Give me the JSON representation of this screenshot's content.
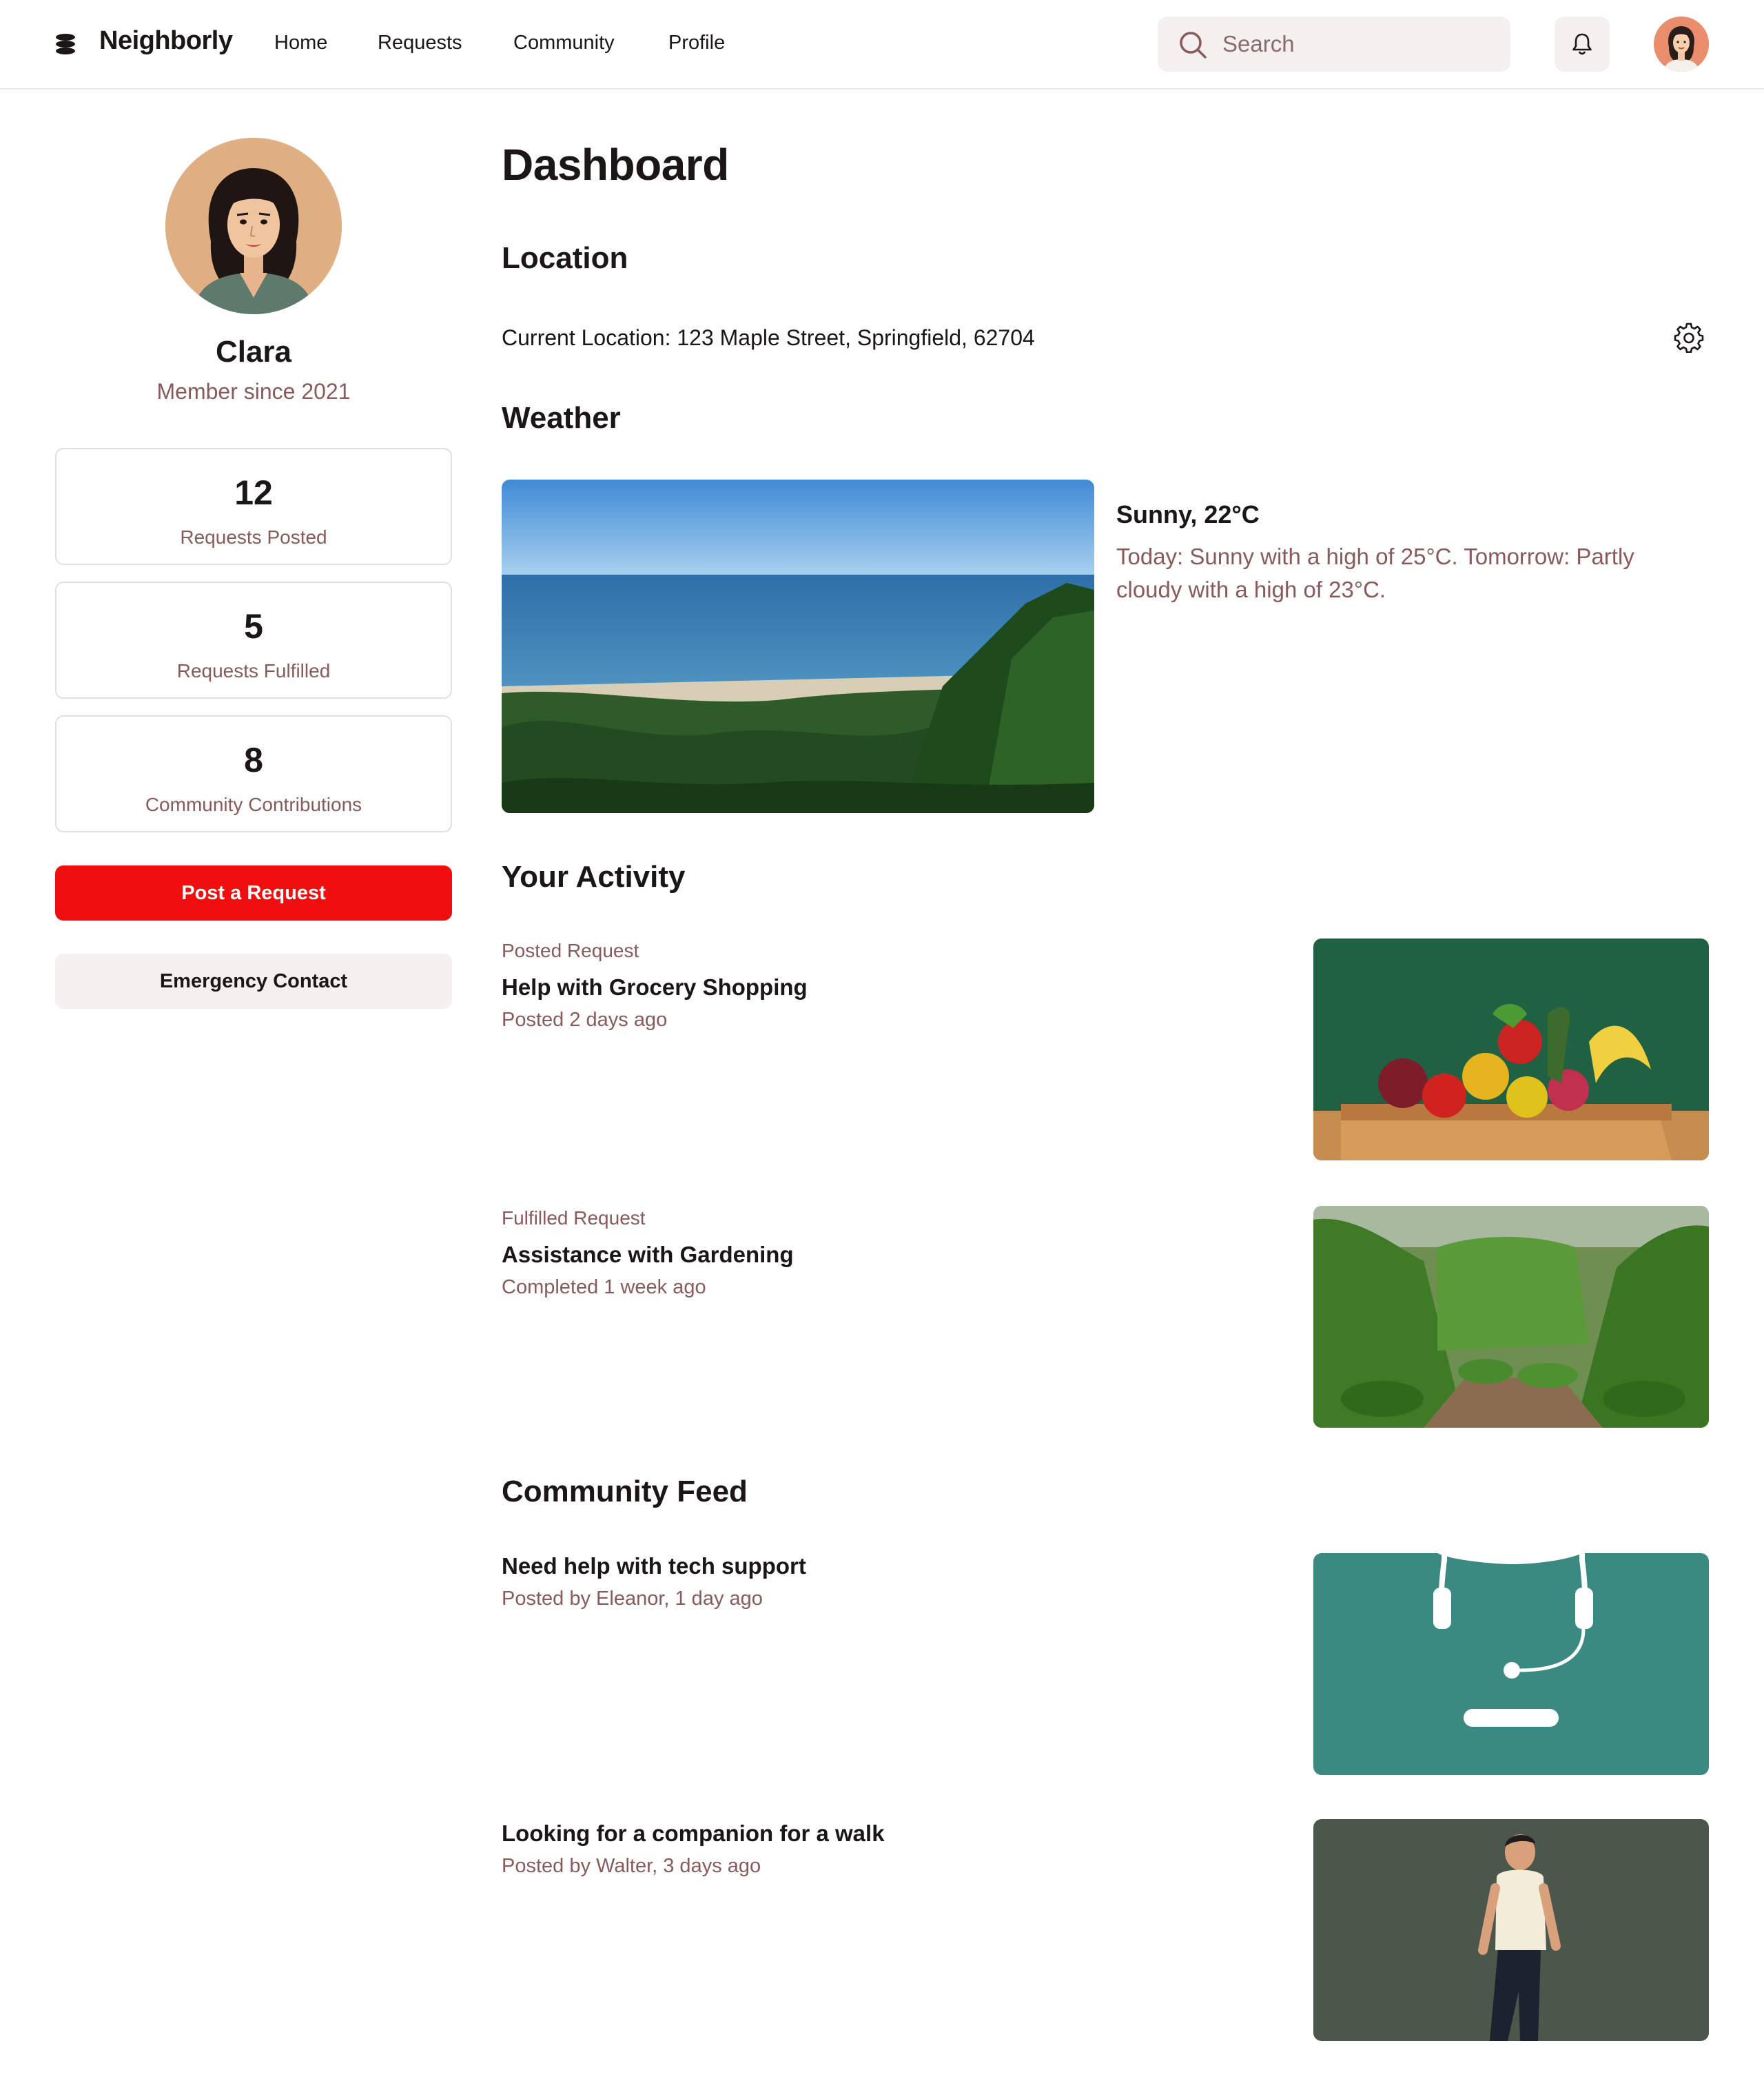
{
  "header": {
    "brand": "Neighborly",
    "nav": [
      "Home",
      "Requests",
      "Community",
      "Profile"
    ],
    "search_placeholder": "Search",
    "icons": [
      "logo-icon",
      "search-icon",
      "bell-icon",
      "avatar"
    ]
  },
  "profile": {
    "name": "Clara",
    "member_since": "Member since 2021",
    "stats": [
      {
        "value": "12",
        "label": "Requests Posted"
      },
      {
        "value": "5",
        "label": "Requests Fulfilled"
      },
      {
        "value": "8",
        "label": "Community Contributions"
      }
    ],
    "primary_button": "Post a Request",
    "secondary_button": "Emergency Contact"
  },
  "main": {
    "title": "Dashboard",
    "location": {
      "heading": "Location",
      "text": "Current Location: 123 Maple Street, Springfield, 62704"
    },
    "weather": {
      "heading": "Weather",
      "summary": "Sunny, 22°C",
      "description": "Today: Sunny with a high of 25°C. Tomorrow: Partly cloudy with a high of 23°C."
    },
    "activity": {
      "heading": "Your Activity",
      "items": [
        {
          "type": "Posted Request",
          "title": "Help with Grocery Shopping",
          "meta": "Posted 2 days ago"
        },
        {
          "type": "Fulfilled Request",
          "title": "Assistance with Gardening",
          "meta": "Completed 1 week ago"
        }
      ]
    },
    "feed": {
      "heading": "Community Feed",
      "items": [
        {
          "title": "Need help with tech support",
          "meta": "Posted by Eleanor, 1 day ago"
        },
        {
          "title": "Looking for a companion for a walk",
          "meta": "Posted by Walter, 3 days ago"
        }
      ]
    }
  },
  "colors": {
    "accent": "#f10e0e",
    "muted_text": "#8a5a5a",
    "surface": "#f4f0f0",
    "border": "#e4dede"
  }
}
